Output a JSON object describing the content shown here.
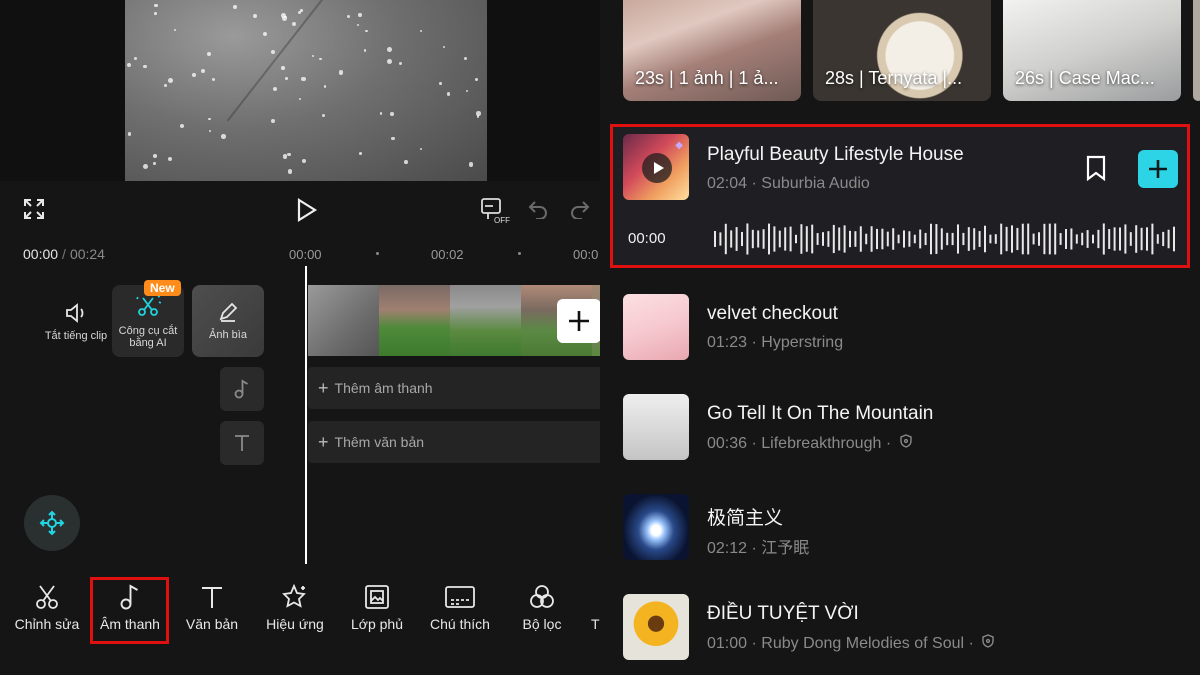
{
  "editor": {
    "timecode": {
      "current": "00:00",
      "separator": "/",
      "total": "00:24"
    },
    "ruler": [
      "00:00",
      "00:02",
      "00:0"
    ],
    "side_buttons": [
      {
        "label": "Tắt tiếng clip",
        "icon": "speaker-icon"
      },
      {
        "label": "Công cụ cắt bằng AI",
        "icon": "ai-scissors-icon",
        "badge": "New"
      },
      {
        "label": "Ảnh bìa",
        "icon": "pencil-icon"
      }
    ],
    "tracks": {
      "audio": "Thêm âm thanh",
      "text": "Thêm văn bản"
    },
    "toolbar": [
      {
        "label": "Chỉnh sửa",
        "icon": "scissors-icon"
      },
      {
        "label": "Âm thanh",
        "icon": "music-note-icon",
        "highlighted": true
      },
      {
        "label": "Văn bản",
        "icon": "text-icon"
      },
      {
        "label": "Hiệu ứng",
        "icon": "sparkle-star-icon"
      },
      {
        "label": "Lớp phủ",
        "icon": "overlay-icon"
      },
      {
        "label": "Chú thích",
        "icon": "captions-icon"
      },
      {
        "label": "Bộ lọc",
        "icon": "filter-icon"
      },
      {
        "label": "T",
        "icon": ""
      }
    ],
    "highlight_color": "#e01010",
    "accent_color": "#21d4e0"
  },
  "music": {
    "thumbnails": [
      {
        "caption": "23s | 1 ảnh  | 1 ả..."
      },
      {
        "caption": "28s | Ternyata |..."
      },
      {
        "caption": "26s | Case Mac..."
      }
    ],
    "selected": {
      "title": "Playful Beauty Lifestyle House",
      "duration": "02:04",
      "artist": "Suburbia Audio",
      "current_time": "00:00"
    },
    "list": [
      {
        "title": "velvet checkout",
        "duration": "01:23",
        "artist": "Hyperstring",
        "shield": false
      },
      {
        "title": "Go Tell It On The Mountain",
        "duration": "00:36",
        "artist": "Lifebreakthrough",
        "shield": true
      },
      {
        "title": "极简主义",
        "duration": "02:12",
        "artist": "江予眠",
        "shield": false
      },
      {
        "title": "ĐIỀU TUYỆT VỜI",
        "duration": "01:00",
        "artist": "Ruby Dong Melodies of Soul",
        "shield": true
      }
    ],
    "meta_separator": "·",
    "add_button_color": "#2dd4e6"
  }
}
